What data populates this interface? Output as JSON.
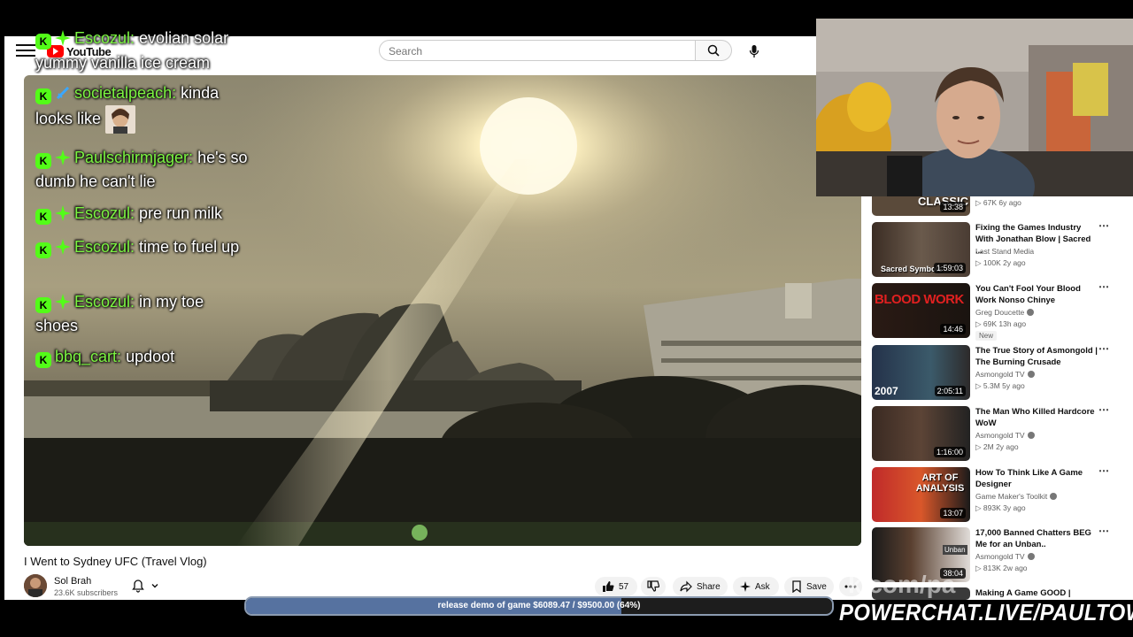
{
  "masthead": {
    "logo_text": "YouTube",
    "search_placeholder": "Search"
  },
  "chat": [
    {
      "user": "Escozul:",
      "message": "evolian solar"
    },
    {
      "user": "",
      "message": "yummy vanilla ice cream"
    },
    {
      "user": "societalpeach:",
      "message": "kinda looks like"
    },
    {
      "user": "Paulschirmjager:",
      "message": "he's so dumb he can't lie"
    },
    {
      "user": "Escozul:",
      "message": "pre run milk"
    },
    {
      "user": "Escozul:",
      "message": "time to fuel up"
    },
    {
      "user": "Escozul:",
      "message": "in my toe shoes"
    },
    {
      "user": "bbq_cart:",
      "message": "updoot"
    }
  ],
  "chat_badge_letter": "K",
  "video": {
    "title": "I Went to Sydney UFC (Travel Vlog)",
    "channel": "Sol Brah",
    "subscribers": "23.6K subscribers",
    "likes": "57",
    "share_label": "Share",
    "ask_label": "Ask",
    "save_label": "Save"
  },
  "recommendations": [
    {
      "title": "",
      "channel": "",
      "meta": "67K  6y ago",
      "duration": "13:38",
      "thumb_text": "CLASSIC"
    },
    {
      "title": "Fixing the Games Industry With Jonathan Blow | Sacred ...",
      "channel": "Last Stand Media",
      "meta": "100K  2y ago",
      "duration": "1:59:03",
      "thumb_text": "Sacred Symbols"
    },
    {
      "title": "You Can't Fool Your Blood Work Nonso Chinye",
      "channel": "Greg Doucette",
      "meta": "69K  13h ago",
      "duration": "14:46",
      "thumb_text": "BLOOD WORK",
      "badge": "New"
    },
    {
      "title": "The True Story of Asmongold | The Burning Crusade",
      "channel": "Asmongold TV",
      "meta": "5.3M  5y ago",
      "duration": "2:05:11",
      "thumb_text": "2007"
    },
    {
      "title": "The Man Who Killed Hardcore WoW",
      "channel": "Asmongold TV",
      "meta": "2M  2y ago",
      "duration": "1:16:00",
      "thumb_text": ""
    },
    {
      "title": "How To Think Like A Game Designer",
      "channel": "Game Maker's Toolkit",
      "meta": "893K  3y ago",
      "duration": "13:07",
      "thumb_text": "ART OF ANALYSIS"
    },
    {
      "title": "17,000 Banned Chatters BEG Me for an Unban..",
      "channel": "Asmongold TV",
      "meta": "813K  2w ago",
      "duration": "38:04",
      "thumb_text": "Unban"
    },
    {
      "title": "Making A Game GOOD |",
      "channel": "",
      "meta": "",
      "duration": "",
      "thumb_text": ""
    }
  ],
  "overlay": {
    "goal_text": "release demo of game $6089.47 / $9500.00 (64%)",
    "goal_fraction": 0.64,
    "promo_text": "POWERCHAT.LIVE/PAULTOWN",
    "watermark_text": "k.com/pa"
  },
  "colors": {
    "chat_username": "#7cf542",
    "kick_green": "#53fc18",
    "goal_fill": "#5672a0"
  }
}
